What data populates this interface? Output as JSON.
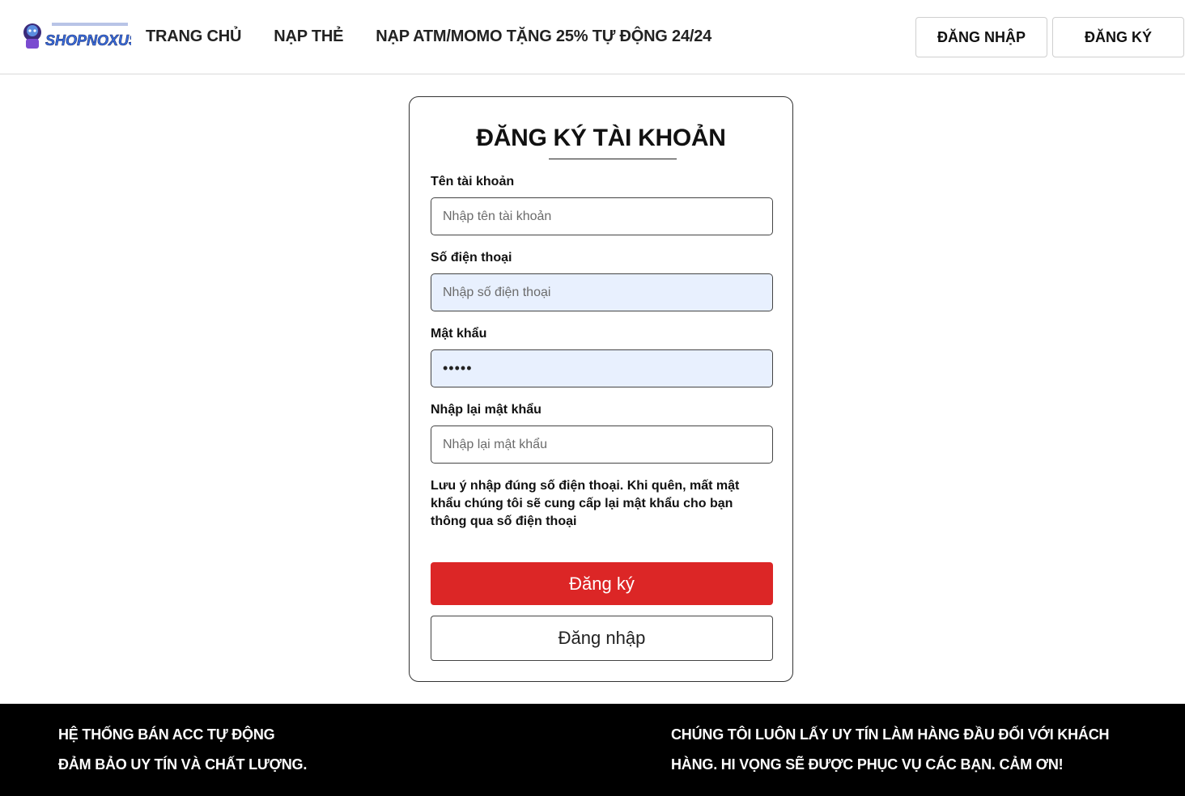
{
  "header": {
    "logo_text": "SHOPNOXUSS.VN",
    "nav": [
      "TRANG CHỦ",
      "NẠP THẺ",
      "NẠP ATM/MOMO TẶNG 25% TỰ ĐỘNG 24/24"
    ],
    "login_label": "ĐĂNG NHẬP",
    "register_label": "ĐĂNG KÝ"
  },
  "form": {
    "title": "ĐĂNG KÝ TÀI KHOẢN",
    "username_label": "Tên tài khoản",
    "username_placeholder": "Nhập tên tài khoản",
    "phone_label": "Số điện thoại",
    "phone_placeholder": "Nhập số điện thoại",
    "password_label": "Mật khẩu",
    "password_value": "•••••",
    "confirm_label": "Nhập lại mật khẩu",
    "confirm_placeholder": "Nhập lại mật khẩu",
    "note": "Lưu ý nhập đúng số điện thoại. Khi quên, mất mật khẩu chúng tôi sẽ cung cấp lại mật khẩu cho bạn thông qua số điện thoại",
    "submit_label": "Đăng ký",
    "login_label": "Đăng nhập"
  },
  "footer": {
    "left_line1": "HỆ THỐNG BÁN ACC TỰ ĐỘNG",
    "left_line2": "ĐẢM BẢO UY TÍN VÀ CHẤT LƯỢNG.",
    "right_text": "CHÚNG TÔI LUÔN LẤY UY TÍN LÀM HÀNG ĐẦU ĐỐI VỚI KHÁCH HÀNG. HI VỌNG SẼ ĐƯỢC PHỤC VỤ CÁC BẠN. CẢM ƠN!"
  },
  "colors": {
    "primary": "#dc2626",
    "autofill": "#e8f0fe",
    "footer_bg": "#000000"
  }
}
